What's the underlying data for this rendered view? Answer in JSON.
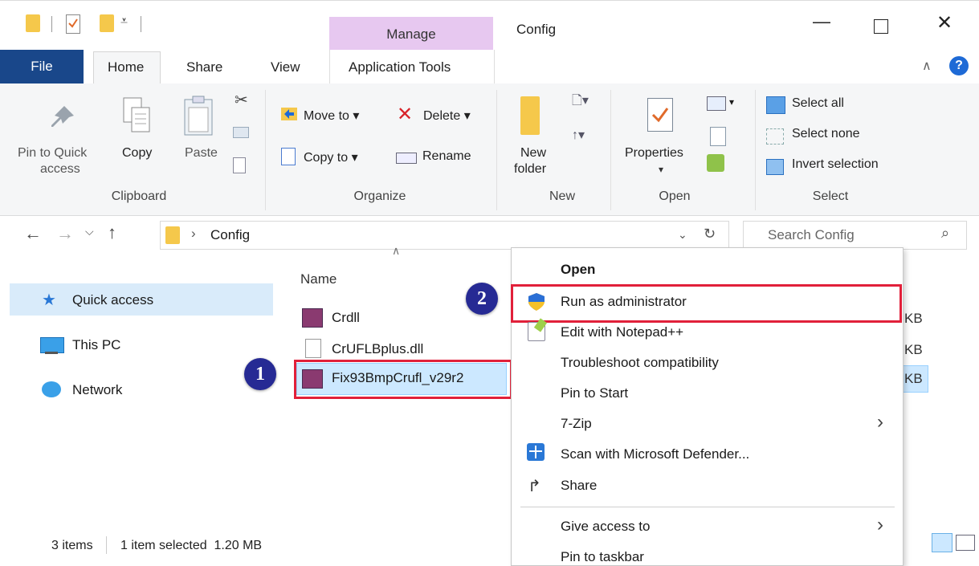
{
  "window": {
    "title": "Config",
    "manage_label": "Manage"
  },
  "menu_tabs": {
    "file": "File",
    "home": "Home",
    "share": "Share",
    "view": "View",
    "app_tools": "Application Tools"
  },
  "ribbon": {
    "clipboard": {
      "pin_line1": "Pin to Quick",
      "pin_line2": "access",
      "copy": "Copy",
      "paste": "Paste",
      "label": "Clipboard"
    },
    "organize": {
      "move_to": "Move to",
      "copy_to": "Copy to",
      "delete": "Delete",
      "rename": "Rename",
      "label": "Organize"
    },
    "new": {
      "folder_line1": "New",
      "folder_line2": "folder",
      "label": "New"
    },
    "open": {
      "properties": "Properties",
      "label": "Open"
    },
    "select": {
      "select_all": "Select all",
      "select_none": "Select none",
      "invert": "Invert selection",
      "label": "Select"
    }
  },
  "address": {
    "path": "Config",
    "search_placeholder": "Search Config"
  },
  "nav": {
    "quick_access": "Quick access",
    "this_pc": "This PC",
    "network": "Network"
  },
  "files": {
    "col_name": "Name",
    "items": [
      "Crdll",
      "CrUFLBplus.dll",
      "Fix93BmpCrufl_v29r2"
    ],
    "sizes": [
      "KB",
      "KB",
      "KB"
    ]
  },
  "badges": {
    "one": "1",
    "two": "2"
  },
  "context_menu": {
    "open": "Open",
    "run_admin": "Run as administrator",
    "notepad": "Edit with Notepad++",
    "troubleshoot": "Troubleshoot compatibility",
    "pin_start": "Pin to Start",
    "zip": "7-Zip",
    "defender": "Scan with Microsoft Defender...",
    "share": "Share",
    "give_access": "Give access to",
    "pin_taskbar": "Pin to taskbar"
  },
  "status": {
    "items": "3 items",
    "selected": "1 item selected  1.20 MB"
  },
  "colors": {
    "file_tab": "#19478a",
    "manage_tab": "#e7c8f0",
    "selection": "#cce8ff",
    "highlight_box": "#e1203a",
    "badge": "#262a94"
  }
}
